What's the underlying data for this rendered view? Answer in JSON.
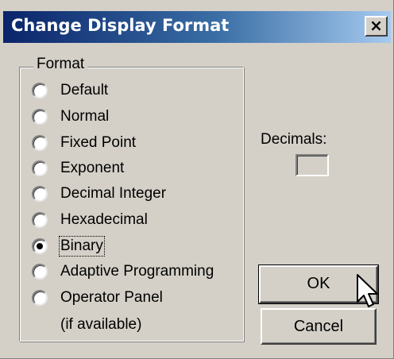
{
  "window": {
    "title": "Change Display Format",
    "close_label": "×"
  },
  "format_group": {
    "legend": "Format",
    "selected": "Binary",
    "options": [
      {
        "label": "Default",
        "checked": false
      },
      {
        "label": "Normal",
        "checked": false
      },
      {
        "label": "Fixed Point",
        "checked": false
      },
      {
        "label": "Exponent",
        "checked": false
      },
      {
        "label": "Decimal Integer",
        "checked": false
      },
      {
        "label": "Hexadecimal",
        "checked": false
      },
      {
        "label": "Binary",
        "checked": true
      },
      {
        "label": "Adaptive Programming",
        "checked": false
      },
      {
        "label": "Operator Panel",
        "checked": false
      }
    ],
    "note": "(if available)"
  },
  "decimals": {
    "label": "Decimals:",
    "value": ""
  },
  "buttons": {
    "ok": "OK",
    "cancel": "Cancel"
  },
  "icons": {
    "cursor": "arrow-pointer-icon",
    "close": "close-icon"
  }
}
